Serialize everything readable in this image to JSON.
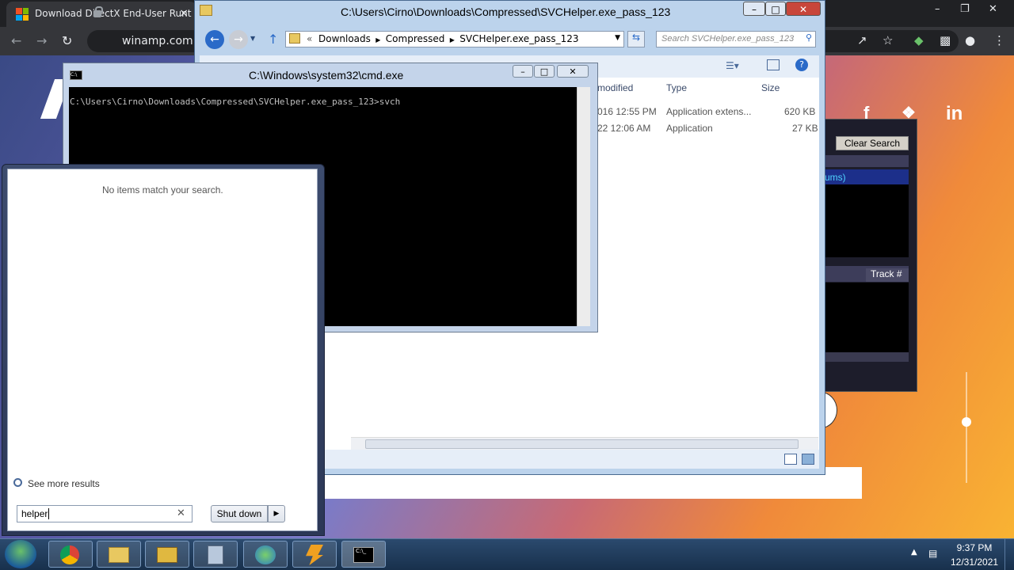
{
  "chrome": {
    "tab_title": "Download DirectX End-User Runt",
    "tab_close": "×",
    "url": "winamp.com",
    "window_controls": [
      "–",
      "❐",
      "✕"
    ]
  },
  "explorer": {
    "title": "C:\\Users\\Cirno\\Downloads\\Compressed\\SVCHelper.exe_pass_123",
    "breadcrumb": [
      "Downloads",
      "Compressed",
      "SVCHelper.exe_pass_123"
    ],
    "search_placeholder": "Search SVCHelper.exe_pass_123",
    "columns": [
      "modified",
      "Type",
      "Size"
    ],
    "rows": [
      {
        "modified": "016 12:55 PM",
        "type": "Application extens...",
        "size": "620 KB"
      },
      {
        "modified": "22 12:06 AM",
        "type": "Application",
        "size": "27 KB"
      }
    ]
  },
  "cmd": {
    "title": "C:\\Windows\\system32\\cmd.exe",
    "prompt_line": "C:\\Users\\Cirno\\Downloads\\Compressed\\SVCHelper.exe_pass_123>svch"
  },
  "winamp": {
    "clear_search": "Clear Search",
    "selected_item": "ums)",
    "track_col": "Track #"
  },
  "start_menu": {
    "no_items": "No items match your search.",
    "see_more": "See more results",
    "search_value": "helper",
    "shutdown": "Shut down"
  },
  "tray": {
    "time": "9:37 PM",
    "date": "12/31/2021"
  },
  "taskbar_apps": [
    "chrome-icon",
    "folder-icon",
    "explorer-icon",
    "install-icon",
    "idm-icon",
    "winamp-icon",
    "cmd-icon"
  ]
}
